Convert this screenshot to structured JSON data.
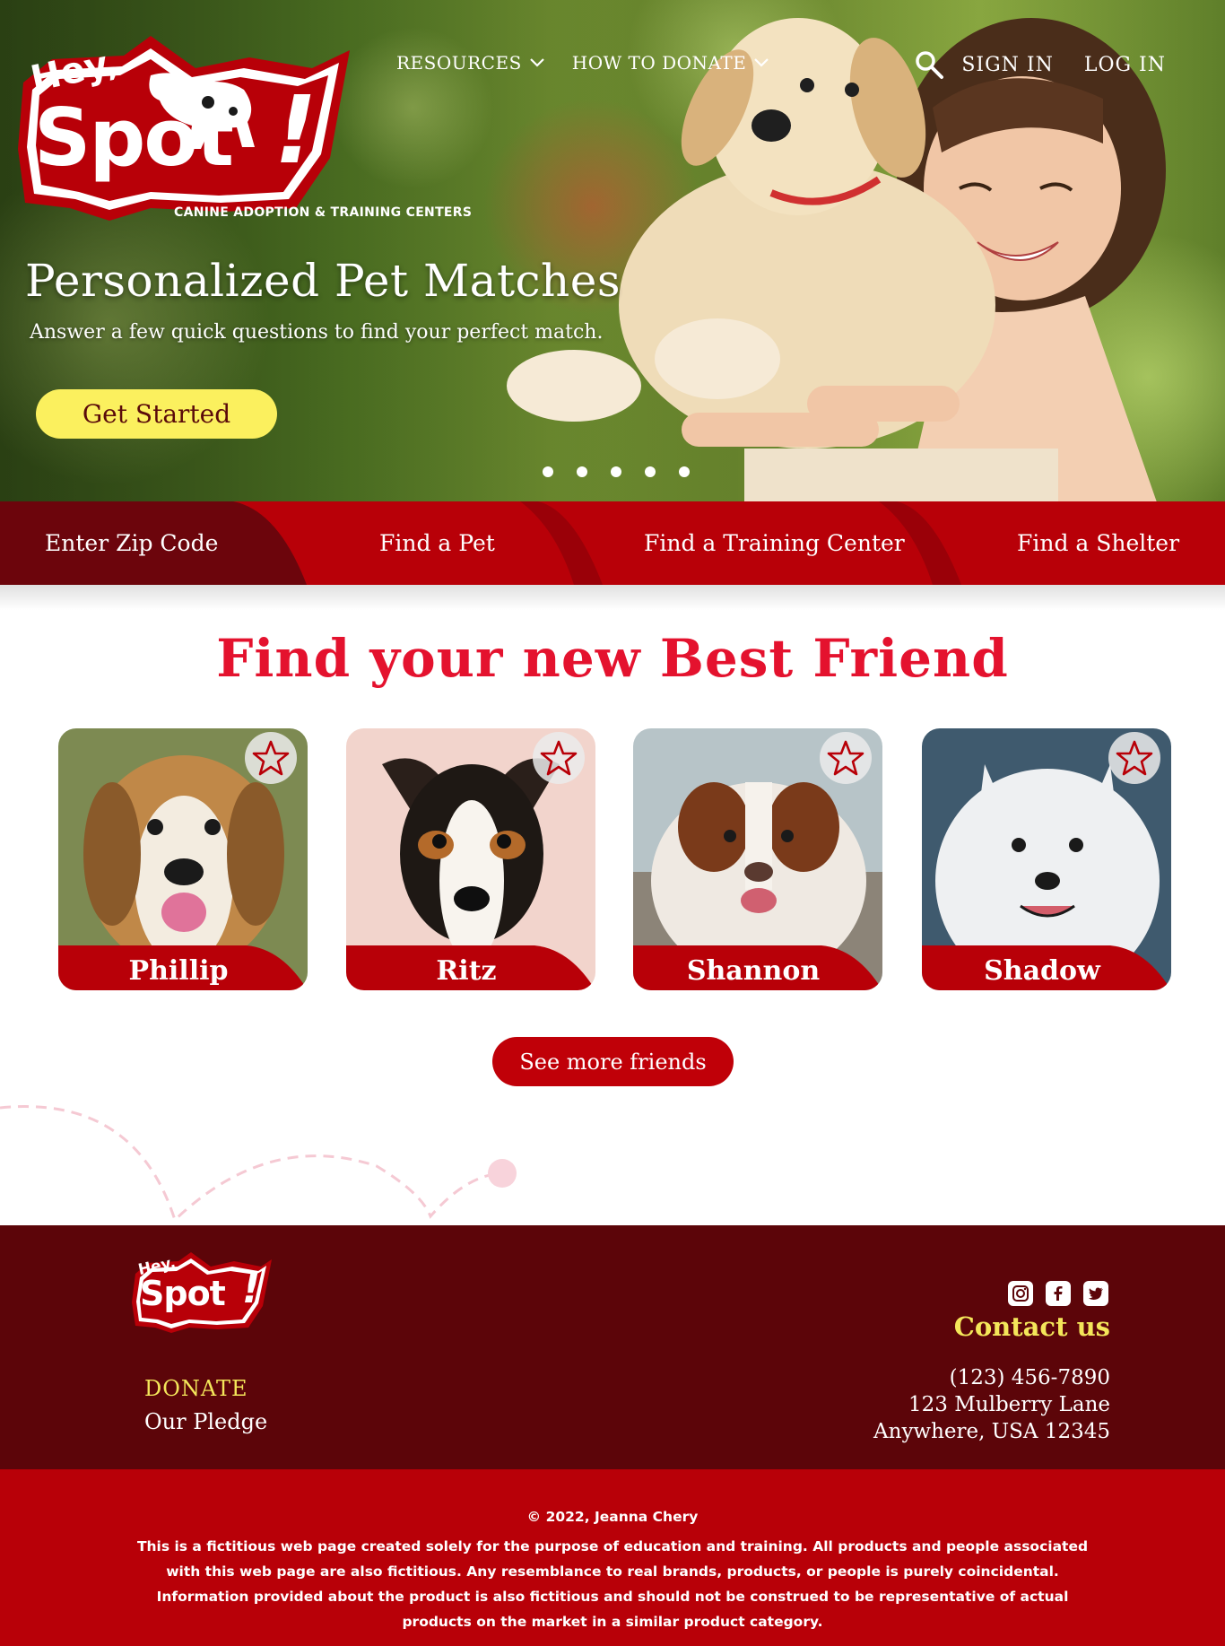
{
  "header": {
    "logo_text_top": "Hey,",
    "logo_text_main": "Spot",
    "logo_text_bang": "!",
    "tagline": "CANINE ADOPTION & TRAINING CENTERS",
    "nav": [
      {
        "label": "RESOURCES"
      },
      {
        "label": "HOW TO DONATE"
      }
    ],
    "sign_in": "SIGN IN",
    "log_in": "LOG IN"
  },
  "hero": {
    "title": "Personalized Pet Matches",
    "subtitle": "Answer a few quick questions to find your perfect match.",
    "cta": "Get Started",
    "slide_count": 5
  },
  "search_bar": {
    "items": [
      "Enter Zip Code",
      "Find a Pet",
      "Find a Training Center",
      "Find a Shelter"
    ]
  },
  "main": {
    "title": "Find your new Best Friend",
    "pets": [
      {
        "name": "Phillip"
      },
      {
        "name": "Ritz"
      },
      {
        "name": "Shannon"
      },
      {
        "name": "Shadow"
      }
    ],
    "see_more": "See more friends"
  },
  "footer": {
    "donate": "DONATE",
    "pledge": "Our Pledge",
    "contact_title": "Contact us",
    "phone": "(123) 456-7890",
    "address1": "123 Mulberry Lane",
    "address2": "Anywhere, USA 12345",
    "social_icons": [
      "instagram-icon",
      "facebook-icon",
      "twitter-icon"
    ],
    "copyright": "© 2022, Jeanna Chery",
    "disclaimer": "This is a fictitious web page created solely for the purpose of education and training. All products and people associated with this web page are also fictitious. Any resemblance to real brands, products, or people is purely coincidental. Information provided about the product is also fictitious and should not be construed to be representative of actual products on the market in a similar product category."
  },
  "colors": {
    "brand_red": "#b80008",
    "dark_red": "#5c0509",
    "title_red": "#e4122e",
    "cta_yellow": "#fbf05e",
    "accent_yellow": "#f4e65a"
  }
}
